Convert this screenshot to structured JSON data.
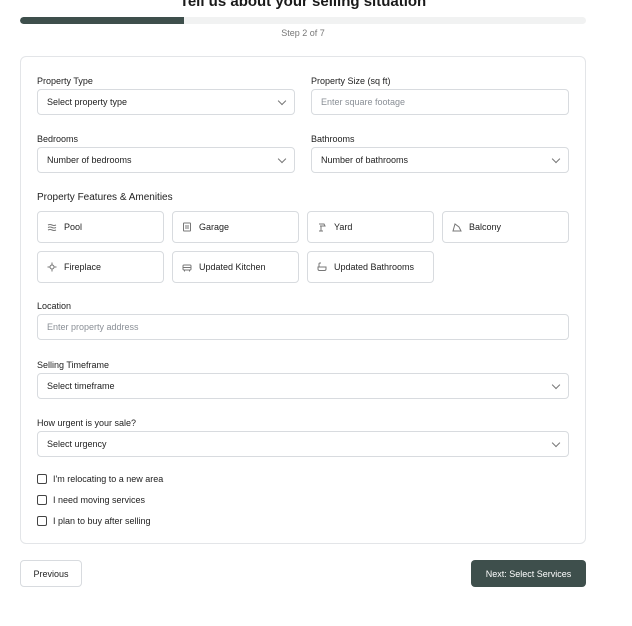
{
  "header": {
    "title": "Tell us about your selling situation",
    "step_text": "Step 2 of 7",
    "progress": 0.29
  },
  "form": {
    "property_type": {
      "label": "Property Type",
      "value": "Select property type"
    },
    "property_size": {
      "label": "Property Size (sq ft)",
      "placeholder": "Enter square footage"
    },
    "bedrooms": {
      "label": "Bedrooms",
      "value": "Number of bedrooms"
    },
    "bathrooms": {
      "label": "Bathrooms",
      "value": "Number of bathrooms"
    },
    "features_title": "Property Features & Amenities",
    "features": [
      {
        "label": "Pool",
        "icon": "waves-icon"
      },
      {
        "label": "Garage",
        "icon": "garage-icon"
      },
      {
        "label": "Yard",
        "icon": "tree-icon"
      },
      {
        "label": "Balcony",
        "icon": "balcony-icon"
      },
      {
        "label": "Fireplace",
        "icon": "fire-icon"
      },
      {
        "label": "Updated Kitchen",
        "icon": "kitchen-icon"
      },
      {
        "label": "Updated Bathrooms",
        "icon": "bath-icon"
      }
    ],
    "location": {
      "label": "Location",
      "placeholder": "Enter property address"
    },
    "timeframe": {
      "label": "Selling Timeframe",
      "value": "Select timeframe"
    },
    "urgency": {
      "label": "How urgent is your sale?",
      "value": "Select urgency"
    },
    "checkboxes": [
      {
        "label": "I'm relocating to a new area",
        "checked": false
      },
      {
        "label": "I need moving services",
        "checked": false
      },
      {
        "label": "I plan to buy after selling",
        "checked": false
      }
    ]
  },
  "footer": {
    "previous_label": "Previous",
    "next_label": "Next: Select Services"
  },
  "colors": {
    "accent": "#3e4f4c",
    "border": "#d8dbdf"
  }
}
